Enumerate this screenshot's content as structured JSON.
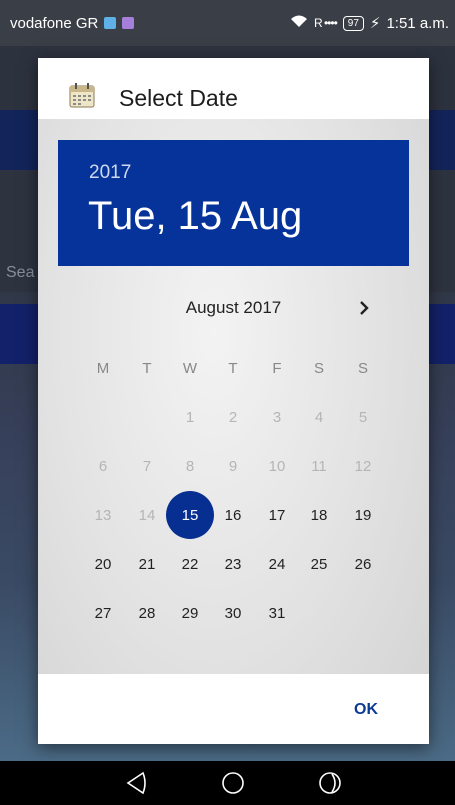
{
  "status_bar": {
    "carrier": "vodafone GR",
    "signal": "R ••••",
    "battery": "97",
    "time": "1:51 a.m."
  },
  "background": {
    "partial_text": "Sea"
  },
  "dialog": {
    "title": "Select Date",
    "year": "2017",
    "selected_date": "Tue, 15 Aug",
    "month_label": "August 2017",
    "weekdays": [
      "M",
      "T",
      "W",
      "T",
      "F",
      "S",
      "S"
    ],
    "days": [
      "1",
      "2",
      "3",
      "4",
      "5",
      "6",
      "7",
      "8",
      "9",
      "10",
      "11",
      "12",
      "13",
      "14",
      "15",
      "16",
      "17",
      "18",
      "19",
      "20",
      "21",
      "22",
      "23",
      "24",
      "25",
      "26",
      "27",
      "28",
      "29",
      "30",
      "31"
    ],
    "first_day_column": 2,
    "last_disabled_day": 14,
    "selected_day": 15,
    "ok_label": "OK"
  },
  "colors": {
    "accent": "#06339a",
    "selected": "#072f91",
    "ok": "#0b3a93"
  },
  "icons": {
    "calendar": "calendar-icon",
    "next": "chevron-right-icon"
  }
}
